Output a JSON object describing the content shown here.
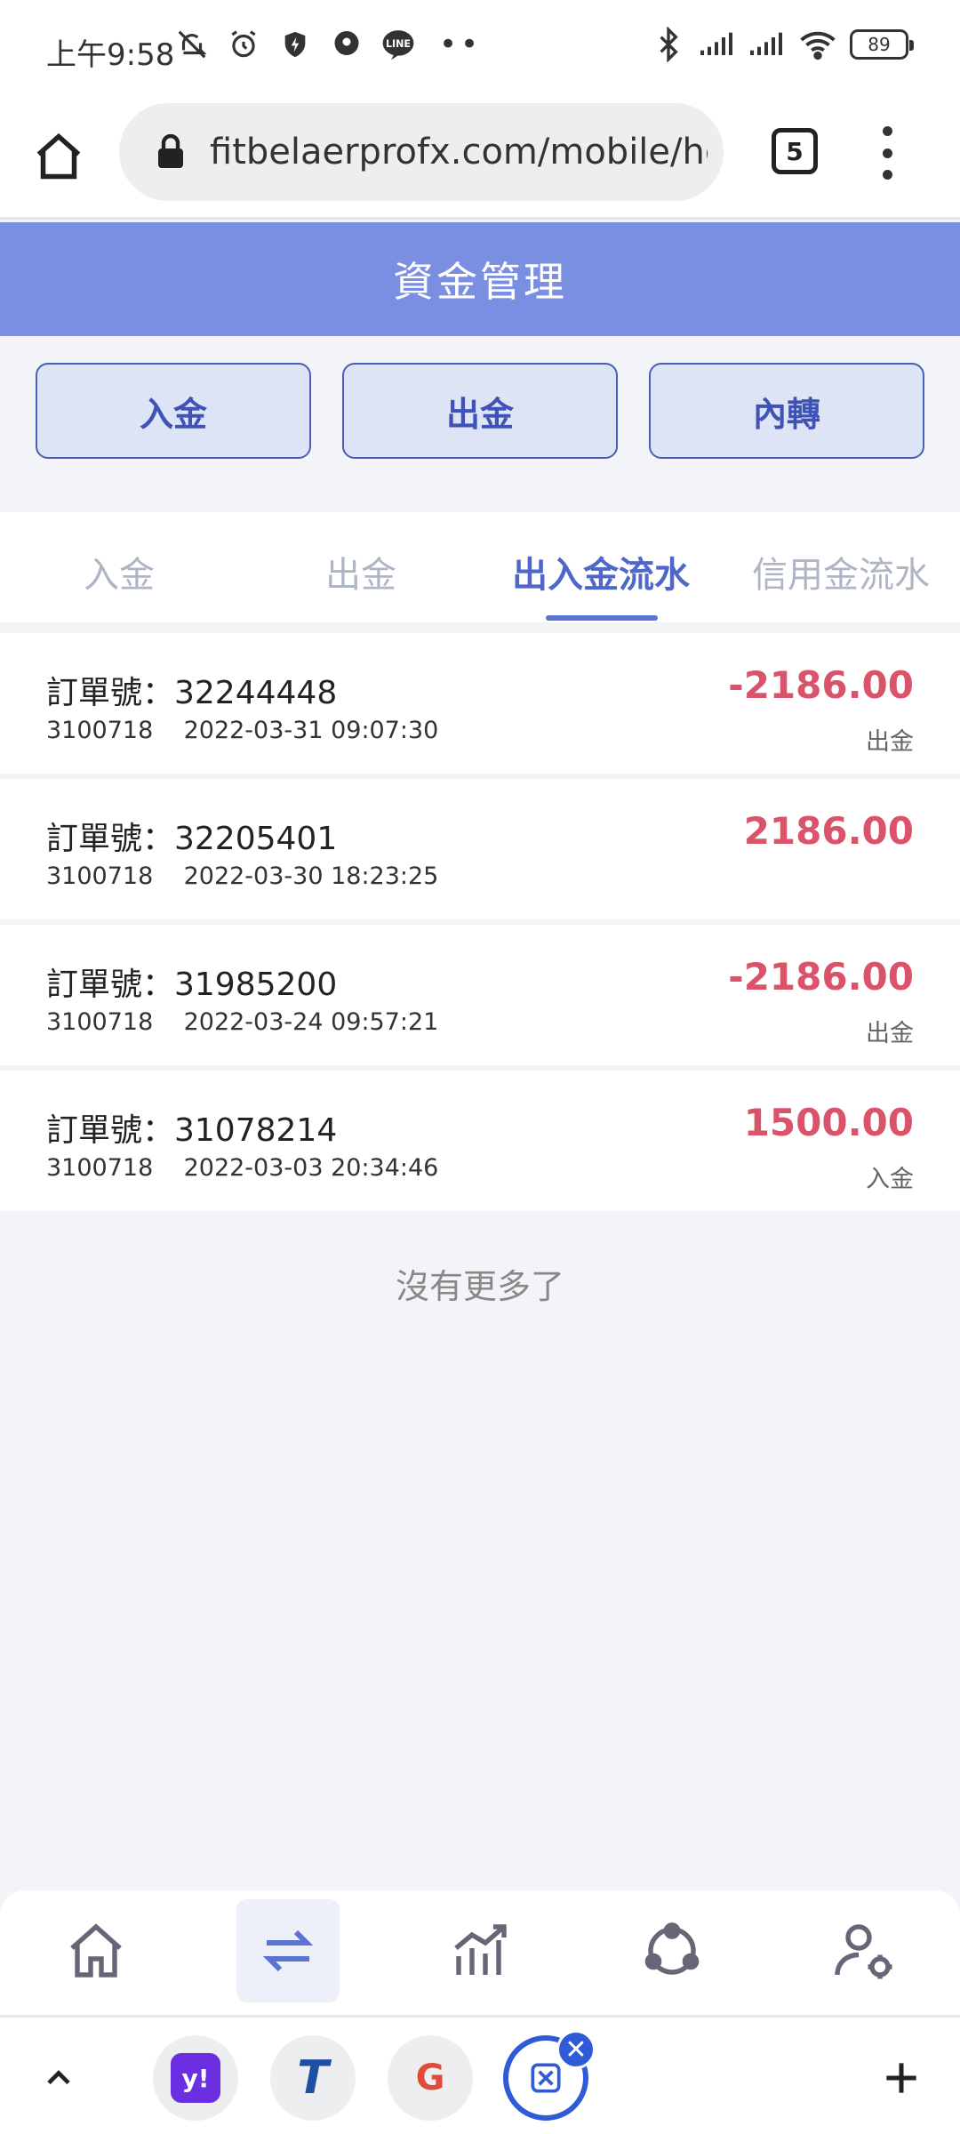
{
  "status_bar": {
    "time": "上午9:58",
    "battery": "89"
  },
  "browser": {
    "url": "fitbelaerprofx.com/mobile/ho",
    "tab_count": "5"
  },
  "page": {
    "title": "資金管理"
  },
  "actions": [
    {
      "label": "入金"
    },
    {
      "label": "出金"
    },
    {
      "label": "內轉"
    }
  ],
  "tabs": [
    {
      "label": "入金",
      "active": false
    },
    {
      "label": "出金",
      "active": false
    },
    {
      "label": "出入金流水",
      "active": true
    },
    {
      "label": "信用金流水",
      "active": false
    }
  ],
  "transactions": [
    {
      "order": "訂單號：32244448",
      "account": "3100718",
      "datetime": "2022-03-31 09:07:30",
      "amount": "-2186.00",
      "type": "出金"
    },
    {
      "order": "訂單號：32205401",
      "account": "3100718",
      "datetime": "2022-03-30 18:23:25",
      "amount": "2186.00",
      "type": ""
    },
    {
      "order": "訂單號：31985200",
      "account": "3100718",
      "datetime": "2022-03-24 09:57:21",
      "amount": "-2186.00",
      "type": "出金"
    },
    {
      "order": "訂單號：31078214",
      "account": "3100718",
      "datetime": "2022-03-03 20:34:46",
      "amount": "1500.00",
      "type": "入金"
    }
  ],
  "list_end_text": "沒有更多了",
  "app_nav": [
    {
      "icon": "home-icon",
      "active": false
    },
    {
      "icon": "transfer-icon",
      "active": true
    },
    {
      "icon": "chart-icon",
      "active": false
    },
    {
      "icon": "network-icon",
      "active": false
    },
    {
      "icon": "user-settings-icon",
      "active": false
    }
  ],
  "browser_toolbar": {
    "shortcuts": [
      "yahoo-icon",
      "t-icon",
      "google-icon"
    ],
    "yahoo_text": "y!",
    "t_text": "T",
    "google_text": "G",
    "close_text": "✕"
  },
  "colors": {
    "header_bg": "#7a8fe2",
    "accent": "#4e67c8",
    "amount": "#d9546a"
  }
}
